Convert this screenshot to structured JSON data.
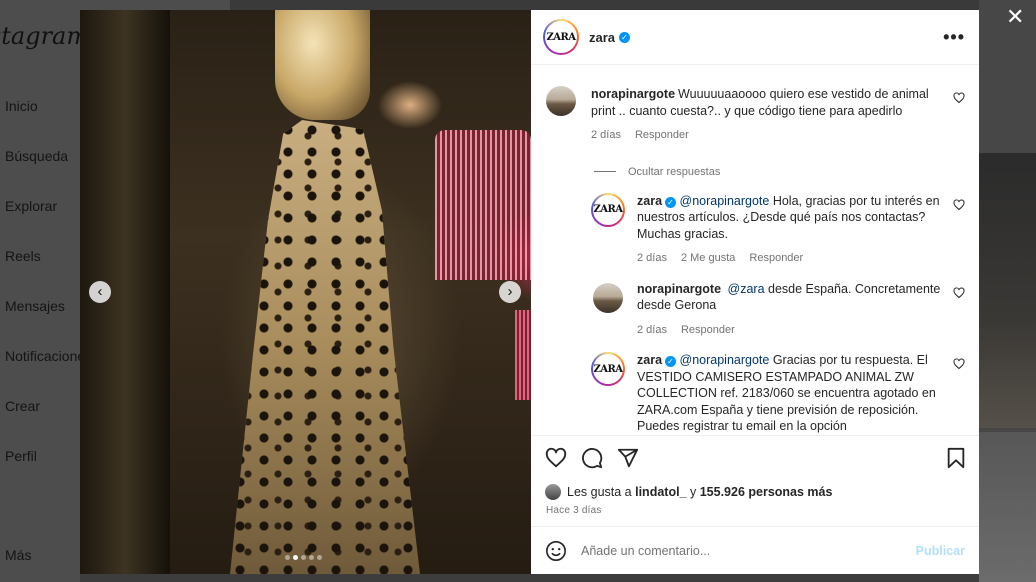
{
  "background": {
    "logo": "Instagram",
    "nav": [
      "Inicio",
      "Búsqueda",
      "Explorar",
      "Reels",
      "Mensajes",
      "Notificaciones",
      "Crear",
      "Perfil",
      "Más"
    ]
  },
  "post": {
    "username": "zara",
    "avatar_text": "ZARA",
    "verified_icon": "✓",
    "more_label": "•••",
    "carousel": {
      "slide_count": 5,
      "active_index": 1,
      "prev_icon": "‹",
      "next_icon": "›"
    },
    "comments": [
      {
        "user": "norapinargote",
        "text": "Wuuuuuaaoooo quiero ese vestido de animal print .. cuanto cuesta?.. y que código tiene para apedirlo",
        "time": "2 días",
        "reply_label": "Responder"
      }
    ],
    "hide_replies_label": "Ocultar respuestas",
    "replies": [
      {
        "user": "zara",
        "verified": true,
        "mention": "@norapinargote",
        "text": " Hola, gracias por tu interés en nuestros artículos. ¿Desde qué país nos contactas? Muchas gracias.",
        "time": "2 días",
        "likes": "2 Me gusta",
        "reply_label": "Responder"
      },
      {
        "user": "norapinargote",
        "verified": false,
        "mention": "@zara",
        "text": " desde España. Concretamente desde Gerona",
        "time": "2 días",
        "likes": "",
        "reply_label": "Responder"
      },
      {
        "user": "zara",
        "verified": true,
        "mention": "@norapinargote",
        "text": " Gracias por tu respuesta. El VESTIDO CAMISERO ESTAMPADO ANIMAL ZW COLLECTION ref. 2183/060 se encuentra agotado en ZARA.com España y tiene previsión de reposición. Puedes registrar tu email en la opción",
        "time": "",
        "likes": "",
        "reply_label": ""
      }
    ],
    "likes_prefix": "Les gusta a ",
    "likes_user": "lindatol_",
    "likes_mid": " y ",
    "likes_count": "155.926 personas más",
    "posted_time": "Hace 3 días",
    "comment_placeholder": "Añade un comentario...",
    "publish_label": "Publicar",
    "close_label": "✕"
  },
  "colors": {
    "verified": "#0095f6",
    "publish_disabled": "#b2dffc",
    "mention": "#00376b",
    "meta": "#737373"
  }
}
